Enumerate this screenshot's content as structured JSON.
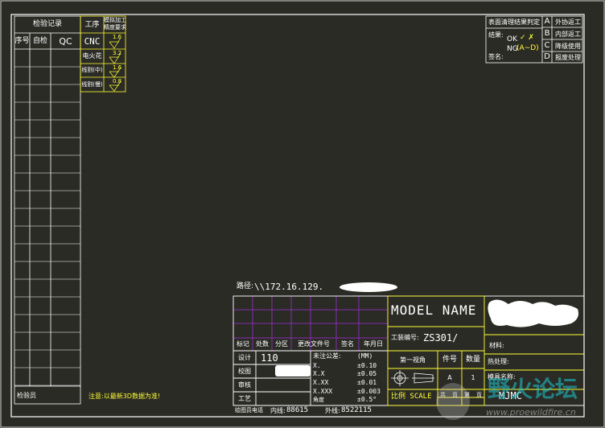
{
  "colors": {
    "background": "#2b2b26",
    "frame": "#ffffff",
    "accent_yellow": "#ffff33",
    "grid_purple": "#9b30d0"
  },
  "inspection": {
    "title": "检验记录",
    "headers": [
      "序号",
      "自检",
      "QC"
    ],
    "footer_label": "检验员"
  },
  "process": {
    "title": "工序",
    "col2_title_line1": "模拟加工",
    "col2_title_line2": "精度要求",
    "rows": [
      {
        "name": "CNC",
        "value": "1.6"
      },
      {
        "name": "电火花",
        "value": "3.2"
      },
      {
        "name": "线割(中)",
        "value": "1.6"
      },
      {
        "name": "线割(慢)",
        "value": "0.8"
      }
    ]
  },
  "judgement": {
    "title": "表面清理结果判定",
    "result_label": "结果:",
    "ok_label": "OK",
    "ok_marks": "✓ ✗",
    "ng_label": "NG",
    "ng_value": "(A~D)",
    "sign_label": "签名:",
    "options": [
      {
        "letter": "A",
        "text": "外协返工"
      },
      {
        "letter": "B",
        "text": "内部返工"
      },
      {
        "letter": "C",
        "text": "降级使用"
      },
      {
        "letter": "D",
        "text": "报废处理"
      }
    ]
  },
  "path": {
    "label": "路径:",
    "value": "\\\\172.16.129."
  },
  "note": "注意:以最新3D数据为准!",
  "revision_headers": [
    "标记",
    "处数",
    "分区",
    "更改文件号",
    "签名",
    "年月日"
  ],
  "approvals": [
    {
      "label": "设计",
      "value": "110"
    },
    {
      "label": "校图",
      "value": ""
    },
    {
      "label": "审核",
      "value": ""
    },
    {
      "label": "工艺",
      "value": ""
    }
  ],
  "tolerance": {
    "title": "未注公差:",
    "unit": "(MM)",
    "rows": [
      {
        "format": "X.",
        "value": "±0.10"
      },
      {
        "format": "X.X",
        "value": "±0.05"
      },
      {
        "format": "X.XX",
        "value": "±0.01"
      },
      {
        "format": "X.XXX",
        "value": "±0.003"
      },
      {
        "format": "角度",
        "value": "±0.5°"
      }
    ]
  },
  "title_block": {
    "model_name": "MODEL NAME",
    "drawing_no_label": "工装编号:",
    "drawing_no_value": "ZS301/",
    "angle_label": "第一视角",
    "part_no_label": "件号",
    "qty_label": "数量",
    "qty_value": "1",
    "part_no_value": "A",
    "scale_label": "比例 SCALE",
    "material_label": "材料:",
    "heat_treat_label": "热处理:",
    "mold_name_label": "模具名称:",
    "mold_name_value": "MJMC",
    "sheet_labels": [
      "共",
      "页",
      "第",
      "页"
    ]
  },
  "contact": {
    "label": "绘图员电话",
    "internal_label": "内线:",
    "internal_value": "88615",
    "external_label": "外线:",
    "external_value": "8522115"
  },
  "watermark": {
    "title": "野火论坛",
    "url": "www.proewildfire.cn"
  }
}
